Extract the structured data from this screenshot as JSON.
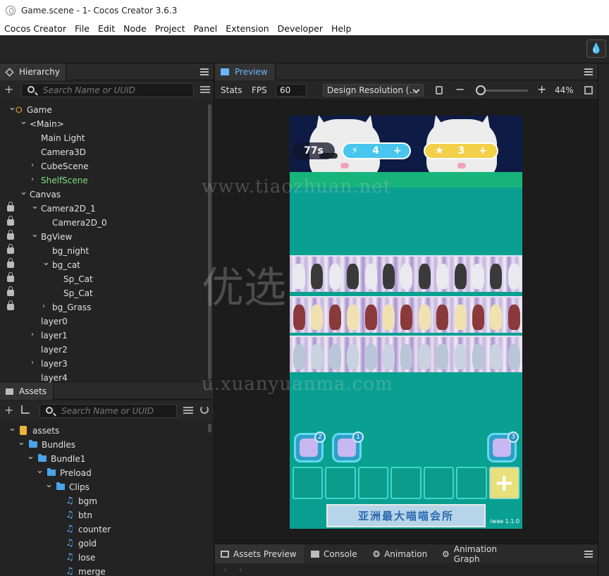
{
  "window": {
    "title": "Game.scene - 1- Cocos Creator 3.6.3"
  },
  "menu": [
    "Cocos Creator",
    "File",
    "Edit",
    "Node",
    "Project",
    "Panel",
    "Extension",
    "Developer",
    "Help"
  ],
  "hierarchy": {
    "tab": "Hierarchy",
    "search_placeholder": "Search Name or UUID",
    "nodes": [
      {
        "label": "Game",
        "depth": 0,
        "arrow": "v",
        "lock": false,
        "icon": "fire"
      },
      {
        "label": "<Main>",
        "depth": 1,
        "arrow": "v",
        "lock": false
      },
      {
        "label": "Main Light",
        "depth": 2,
        "arrow": "",
        "lock": false
      },
      {
        "label": "Camera3D",
        "depth": 2,
        "arrow": "",
        "lock": false
      },
      {
        "label": "CubeScene",
        "depth": 2,
        "arrow": ">",
        "lock": false
      },
      {
        "label": "ShelfScene",
        "depth": 2,
        "arrow": ">",
        "lock": false,
        "selected": true
      },
      {
        "label": "Canvas",
        "depth": 1,
        "arrow": "v",
        "lock": false
      },
      {
        "label": "Camera2D_1",
        "depth": 2,
        "arrow": "v",
        "lock": true
      },
      {
        "label": "Camera2D_0",
        "depth": 3,
        "arrow": "",
        "lock": true
      },
      {
        "label": "BgView",
        "depth": 2,
        "arrow": "v",
        "lock": true
      },
      {
        "label": "bg_night",
        "depth": 3,
        "arrow": "",
        "lock": true
      },
      {
        "label": "bg_cat",
        "depth": 3,
        "arrow": "v",
        "lock": true
      },
      {
        "label": "Sp_Cat",
        "depth": 4,
        "arrow": "",
        "lock": true
      },
      {
        "label": "Sp_Cat",
        "depth": 4,
        "arrow": "",
        "lock": true
      },
      {
        "label": "bg_Grass",
        "depth": 3,
        "arrow": ">",
        "lock": true
      },
      {
        "label": "layer0",
        "depth": 2,
        "arrow": "",
        "lock": false
      },
      {
        "label": "layer1",
        "depth": 2,
        "arrow": ">",
        "lock": false
      },
      {
        "label": "layer2",
        "depth": 2,
        "arrow": "",
        "lock": false
      },
      {
        "label": "layer3",
        "depth": 2,
        "arrow": ">",
        "lock": false
      },
      {
        "label": "layer4",
        "depth": 2,
        "arrow": "",
        "lock": false
      }
    ]
  },
  "assets": {
    "tab": "Assets",
    "search_placeholder": "Search Name or UUID",
    "items": [
      {
        "label": "assets",
        "depth": 0,
        "arrow": "v",
        "icon": "db"
      },
      {
        "label": "Bundles",
        "depth": 1,
        "arrow": "v",
        "icon": "folder"
      },
      {
        "label": "Bundle1",
        "depth": 2,
        "arrow": "v",
        "icon": "folder"
      },
      {
        "label": "Preload",
        "depth": 3,
        "arrow": "v",
        "icon": "folder"
      },
      {
        "label": "Clips",
        "depth": 4,
        "arrow": "v",
        "icon": "folder"
      },
      {
        "label": "bgm",
        "depth": 5,
        "arrow": "",
        "icon": "audio"
      },
      {
        "label": "btn",
        "depth": 5,
        "arrow": "",
        "icon": "audio"
      },
      {
        "label": "counter",
        "depth": 5,
        "arrow": "",
        "icon": "audio"
      },
      {
        "label": "gold",
        "depth": 5,
        "arrow": "",
        "icon": "audio"
      },
      {
        "label": "lose",
        "depth": 5,
        "arrow": "",
        "icon": "audio"
      },
      {
        "label": "merge",
        "depth": 5,
        "arrow": "",
        "icon": "audio"
      }
    ]
  },
  "preview": {
    "tab": "Preview",
    "stats_label": "Stats",
    "fps_label": "FPS",
    "fps_value": "60",
    "resolution": "Design Resolution (...",
    "zoom": "44%",
    "zoom_fraction": 0.1
  },
  "game": {
    "timer": "77s",
    "energy": "4",
    "stars": "3",
    "banner": "亚洲最大喵喵会所",
    "version": "iwae 1.1.0",
    "shuffle_count": "2",
    "freeze_count": "1",
    "undo_count": "3"
  },
  "watermarks": [
    "www.tiaozhuan.net",
    "优选",
    "u.xuanyuanma.com"
  ],
  "bottom_tabs": [
    "Assets Preview",
    "Console",
    "Animation",
    "Animation Graph"
  ],
  "colors": {
    "accent": "#6ab6ff",
    "selected": "#7ee07e",
    "game_bg": "#0aa091"
  }
}
